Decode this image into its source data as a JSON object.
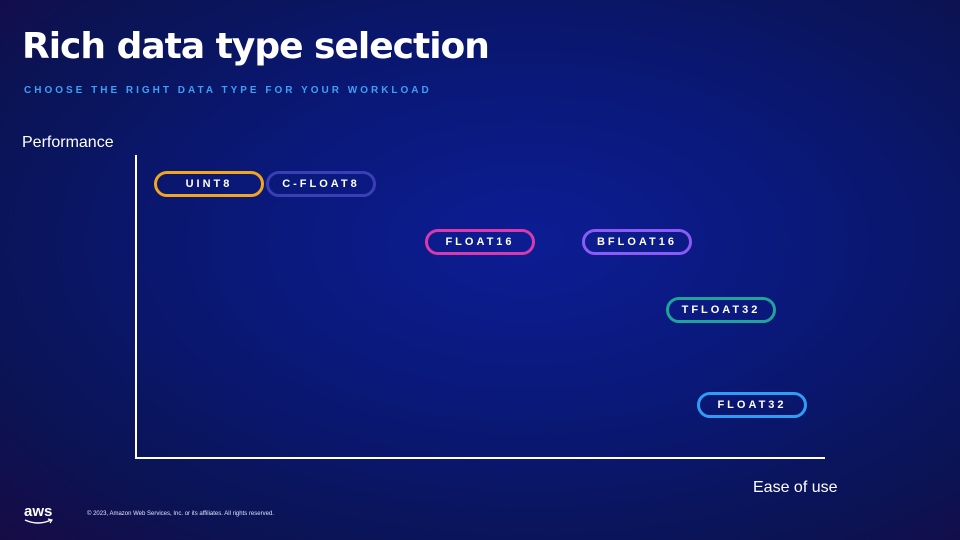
{
  "title": "Rich data type selection",
  "subtitle": "CHOOSE THE RIGHT DATA TYPE FOR YOUR WORKLOAD",
  "y_axis_label": "Performance",
  "x_axis_label": "Ease of use",
  "data_types": [
    {
      "label": "UINT8",
      "color": "#f2a51f"
    },
    {
      "label": "C-FLOAT8",
      "color": "#3a3fb5"
    },
    {
      "label": "FLOAT16",
      "color": "#d83aae"
    },
    {
      "label": "BFLOAT16",
      "color": "#8a5cf5"
    },
    {
      "label": "TFLOAT32",
      "color": "#1fa39a"
    },
    {
      "label": "FLOAT32",
      "color": "#2f9cf5"
    }
  ],
  "footer": {
    "logo": "aws",
    "copyright": "© 2023, Amazon Web Services, Inc. or its affiliates. All rights reserved."
  }
}
